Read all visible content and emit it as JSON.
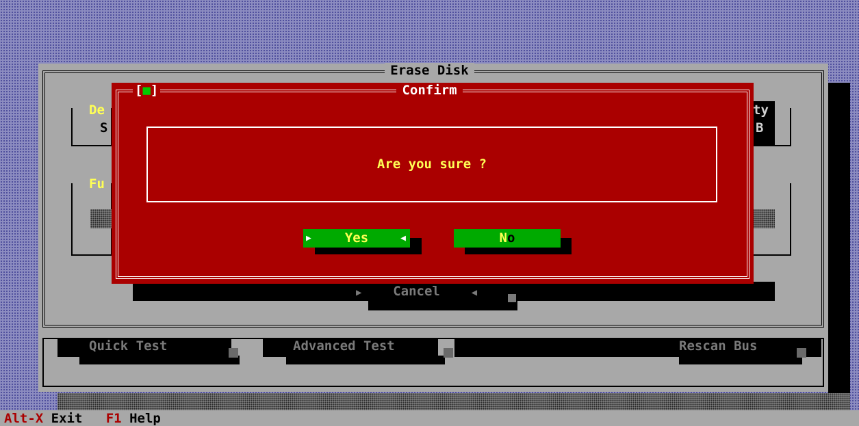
{
  "erase_window": {
    "title": "Erase Disk"
  },
  "fragments": {
    "top_left": "De",
    "top_left_2": "S",
    "mid_left": "Fu",
    "top_right": "ty",
    "top_right_2": "B"
  },
  "confirm_dialog": {
    "title": "Confirm",
    "close_left": "[",
    "close_mark": "■",
    "close_right": "]",
    "message": "Are you sure ?",
    "yes_label": "Yes",
    "no_label_hot": "N",
    "no_label_rest": "o"
  },
  "cancel_button": {
    "label": "Cancel"
  },
  "bottom_buttons": {
    "quick_test": "Quick Test",
    "advanced_test": "Advanced Test",
    "rescan_bus": "Rescan Bus"
  },
  "status_bar": {
    "alt_x_key": "Alt-X",
    "alt_x_label": " Exit",
    "f1_key": "F1",
    "f1_label": " Help"
  },
  "glyphs": {
    "arrow_right": "▶",
    "arrow_left": "◀",
    "square": "■"
  },
  "colors": {
    "dialog_red": "#aa0000",
    "button_green": "#00aa00",
    "highlight_yellow": "#ffff55",
    "window_gray": "#a8a8a8"
  }
}
